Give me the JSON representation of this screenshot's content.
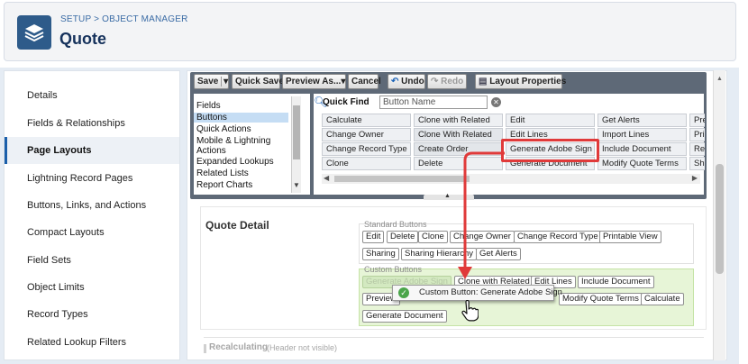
{
  "header": {
    "breadcrumb": "SETUP > OBJECT MANAGER",
    "title": "Quote",
    "icon": "layers-icon"
  },
  "sidebar": {
    "items": [
      {
        "label": "Details",
        "active": false
      },
      {
        "label": "Fields & Relationships",
        "active": false
      },
      {
        "label": "Page Layouts",
        "active": true
      },
      {
        "label": "Lightning Record Pages",
        "active": false
      },
      {
        "label": "Buttons, Links, and Actions",
        "active": false
      },
      {
        "label": "Compact Layouts",
        "active": false
      },
      {
        "label": "Field Sets",
        "active": false
      },
      {
        "label": "Object Limits",
        "active": false
      },
      {
        "label": "Record Types",
        "active": false
      },
      {
        "label": "Related Lookup Filters",
        "active": false
      }
    ]
  },
  "toolbar": {
    "save": "Save",
    "quick_save": "Quick Save",
    "preview_as": "Preview As...",
    "cancel": "Cancel",
    "undo": "Undo",
    "redo": "Redo",
    "layout_properties": "Layout Properties"
  },
  "palette": {
    "categories": [
      "Fields",
      "Buttons",
      "Quick Actions",
      "Mobile & Lightning Actions",
      "Expanded Lookups",
      "Related Lists",
      "Report Charts"
    ],
    "selected_category": "Buttons",
    "quick_find_label": "Quick Find",
    "quick_find_placeholder": "Button Name",
    "grid": [
      [
        "Calculate",
        "Clone with Related",
        "Edit",
        "Get Alerts",
        "Pre"
      ],
      [
        "Change Owner",
        "Clone With Related",
        "Edit Lines",
        "Import Lines",
        "Pri"
      ],
      [
        "Change Record Type",
        "Create Order",
        "Generate Adobe Sign",
        "Include Document",
        "Re"
      ],
      [
        "Clone",
        "Delete",
        "Generate Document",
        "Modify Quote Terms",
        "Sh"
      ]
    ]
  },
  "section": {
    "title": "Quote Detail",
    "standard_label": "Standard Buttons",
    "standard_buttons": [
      "Edit",
      "Delete",
      "Clone",
      "Change Owner",
      "Change Record Type",
      "Printable View",
      "Sharing",
      "Sharing Hierarchy",
      "Get Alerts"
    ],
    "custom_label": "Custom Buttons",
    "custom_buttons": [
      "Generate Adobe Sign",
      "Clone with Related",
      "Edit Lines",
      "Include Document",
      "Preview",
      "Modify Quote Terms",
      "Calculate",
      "Generate Document"
    ],
    "drag_tooltip": "Custom Button:  Generate Adobe Sign"
  },
  "recalc": {
    "title": "Recalculating",
    "note": "(Header not visible)"
  },
  "colors": {
    "highlight": "#e03a3a",
    "palette_bg": "#5e6977",
    "custom_group_bg": "#e7f5d7",
    "brand_icon": "#2e5b8a"
  }
}
